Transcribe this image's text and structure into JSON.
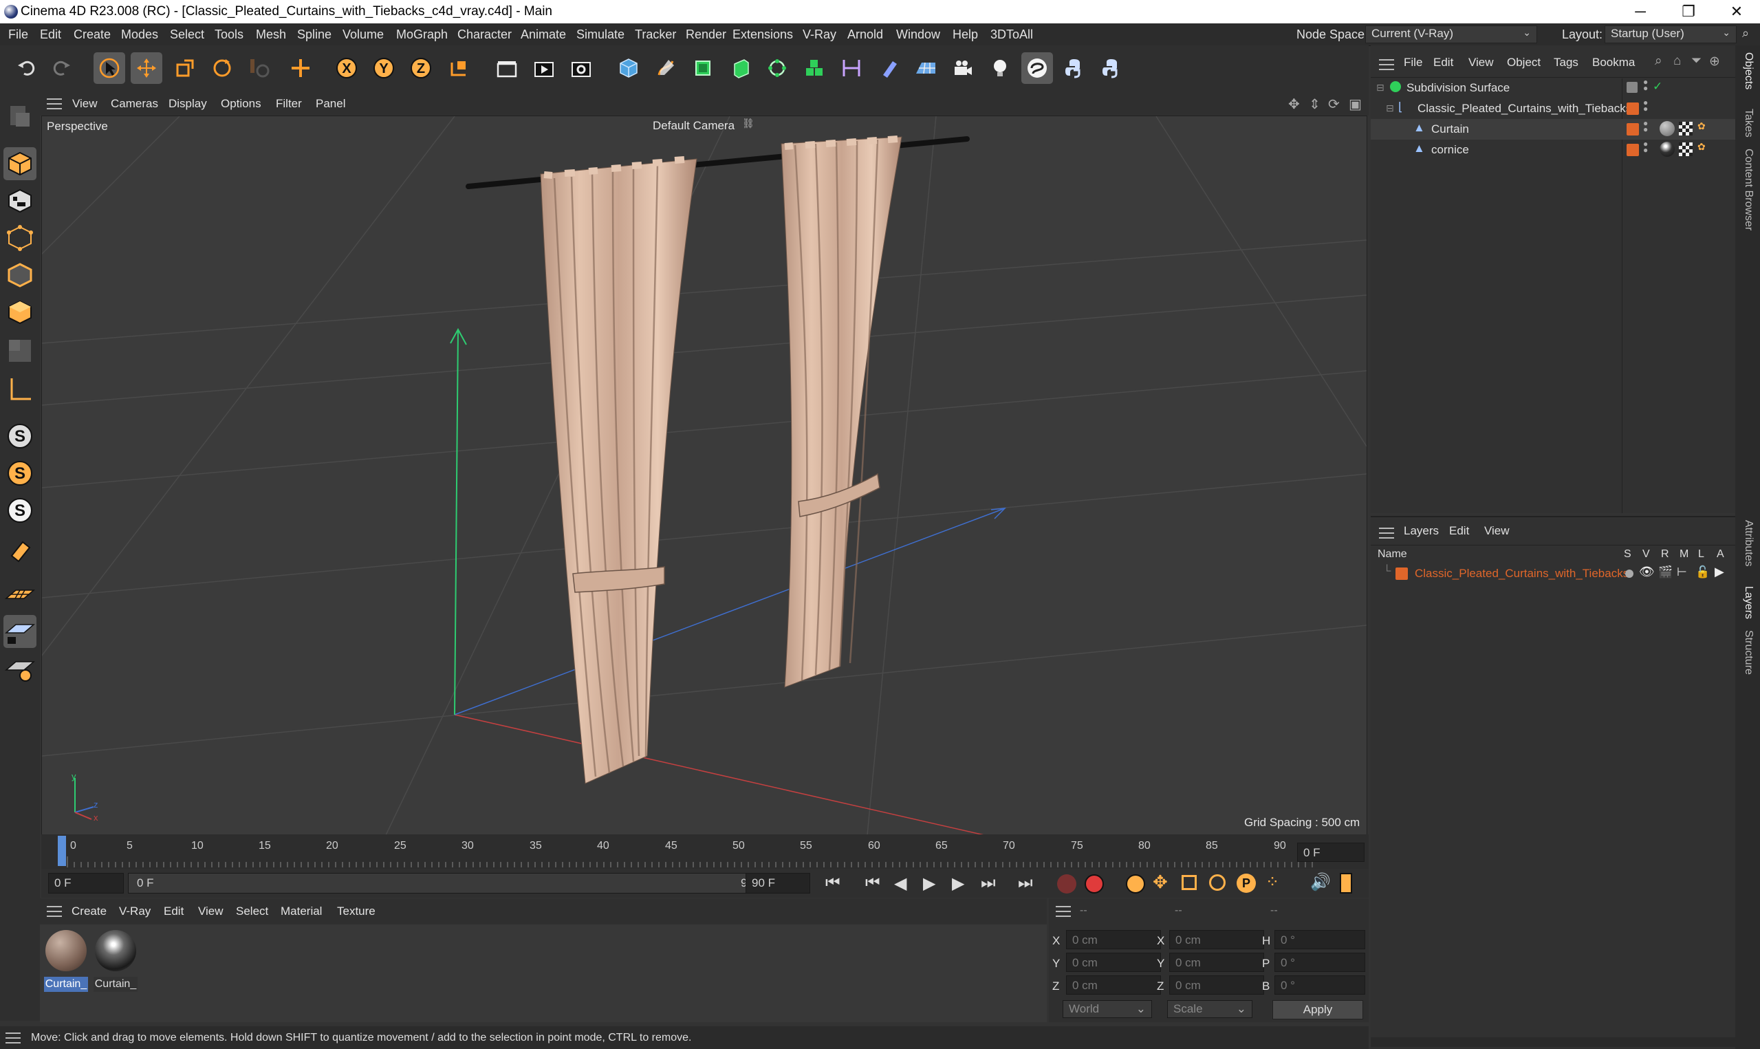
{
  "window": {
    "title": "Cinema 4D R23.008 (RC) - [Classic_Pleated_Curtains_with_Tiebacks_c4d_vray.c4d] - Main",
    "controls": [
      "─",
      "❐",
      "✕"
    ]
  },
  "menubar": {
    "items": [
      "File",
      "Edit",
      "Create",
      "Modes",
      "Select",
      "Tools",
      "Mesh",
      "Spline",
      "Volume",
      "MoGraph",
      "Character",
      "Animate",
      "Simulate",
      "Tracker",
      "Render",
      "Extensions",
      "V-Ray",
      "Arnold",
      "Window",
      "Help",
      "3DToAll"
    ],
    "node_space_label": "Node Space:",
    "node_space_value": "Current (V-Ray)",
    "layout_label": "Layout:",
    "layout_value": "Startup (User)"
  },
  "viewport": {
    "menu": [
      "View",
      "Cameras",
      "Display",
      "Options",
      "Filter",
      "Panel"
    ],
    "projection": "Perspective",
    "camera": "Default Camera",
    "grid_spacing": "Grid Spacing : 500 cm",
    "axis_y": "y",
    "axis_z": "z",
    "axis_x": "x"
  },
  "timeline": {
    "ticks": [
      "0",
      "5",
      "10",
      "15",
      "20",
      "25",
      "30",
      "35",
      "40",
      "45",
      "50",
      "55",
      "60",
      "65",
      "70",
      "75",
      "80",
      "85",
      "90"
    ],
    "current_frame": "0 F",
    "start_field": "0 F",
    "range_start": "0 F",
    "range_end": "90 F",
    "end_field": "90 F"
  },
  "materials": {
    "menu": [
      "Create",
      "V-Ray",
      "Edit",
      "View",
      "Select",
      "Material",
      "Texture"
    ],
    "items": [
      {
        "label": "Curtain_",
        "kind": "matte"
      },
      {
        "label": "Curtain_",
        "kind": "glossy"
      }
    ]
  },
  "coords": {
    "header": [
      "--",
      "--",
      "--"
    ],
    "rows": [
      {
        "a_label": "X",
        "a_value": "0 cm",
        "b_label": "X",
        "b_value": "0 cm",
        "c_label": "H",
        "c_value": "0 °"
      },
      {
        "a_label": "Y",
        "a_value": "0 cm",
        "b_label": "Y",
        "b_value": "0 cm",
        "c_label": "P",
        "c_value": "0 °"
      },
      {
        "a_label": "Z",
        "a_value": "0 cm",
        "b_label": "Z",
        "b_value": "0 cm",
        "c_label": "B",
        "c_value": "0 °"
      }
    ],
    "mode": "World",
    "scale": "Scale",
    "apply": "Apply"
  },
  "status": "Move: Click and drag to move elements. Hold down SHIFT to quantize movement / add to the selection in point mode, CTRL to remove.",
  "objects": {
    "menu": [
      "File",
      "Edit",
      "View",
      "Object",
      "Tags",
      "Bookma"
    ],
    "rows": [
      {
        "name": "Subdivision Surface"
      },
      {
        "name": "Classic_Pleated_Curtains_with_Tiebacks"
      },
      {
        "name": "Curtain"
      },
      {
        "name": "cornice"
      }
    ]
  },
  "layers": {
    "menu": [
      "Layers",
      "Edit",
      "View"
    ],
    "columns": [
      "Name",
      "S",
      "V",
      "R",
      "M",
      "L",
      "A"
    ],
    "rows": [
      {
        "name": "Classic_Pleated_Curtains_with_Tiebacks"
      }
    ]
  },
  "side_tabs": [
    "Objects",
    "Takes",
    "Content Browser",
    "Attributes",
    "Layers",
    "Structure"
  ],
  "colors": {
    "accent_orange": "#e0662a",
    "selection_blue": "#4a73b8",
    "curtain": "#d8b6a0"
  }
}
